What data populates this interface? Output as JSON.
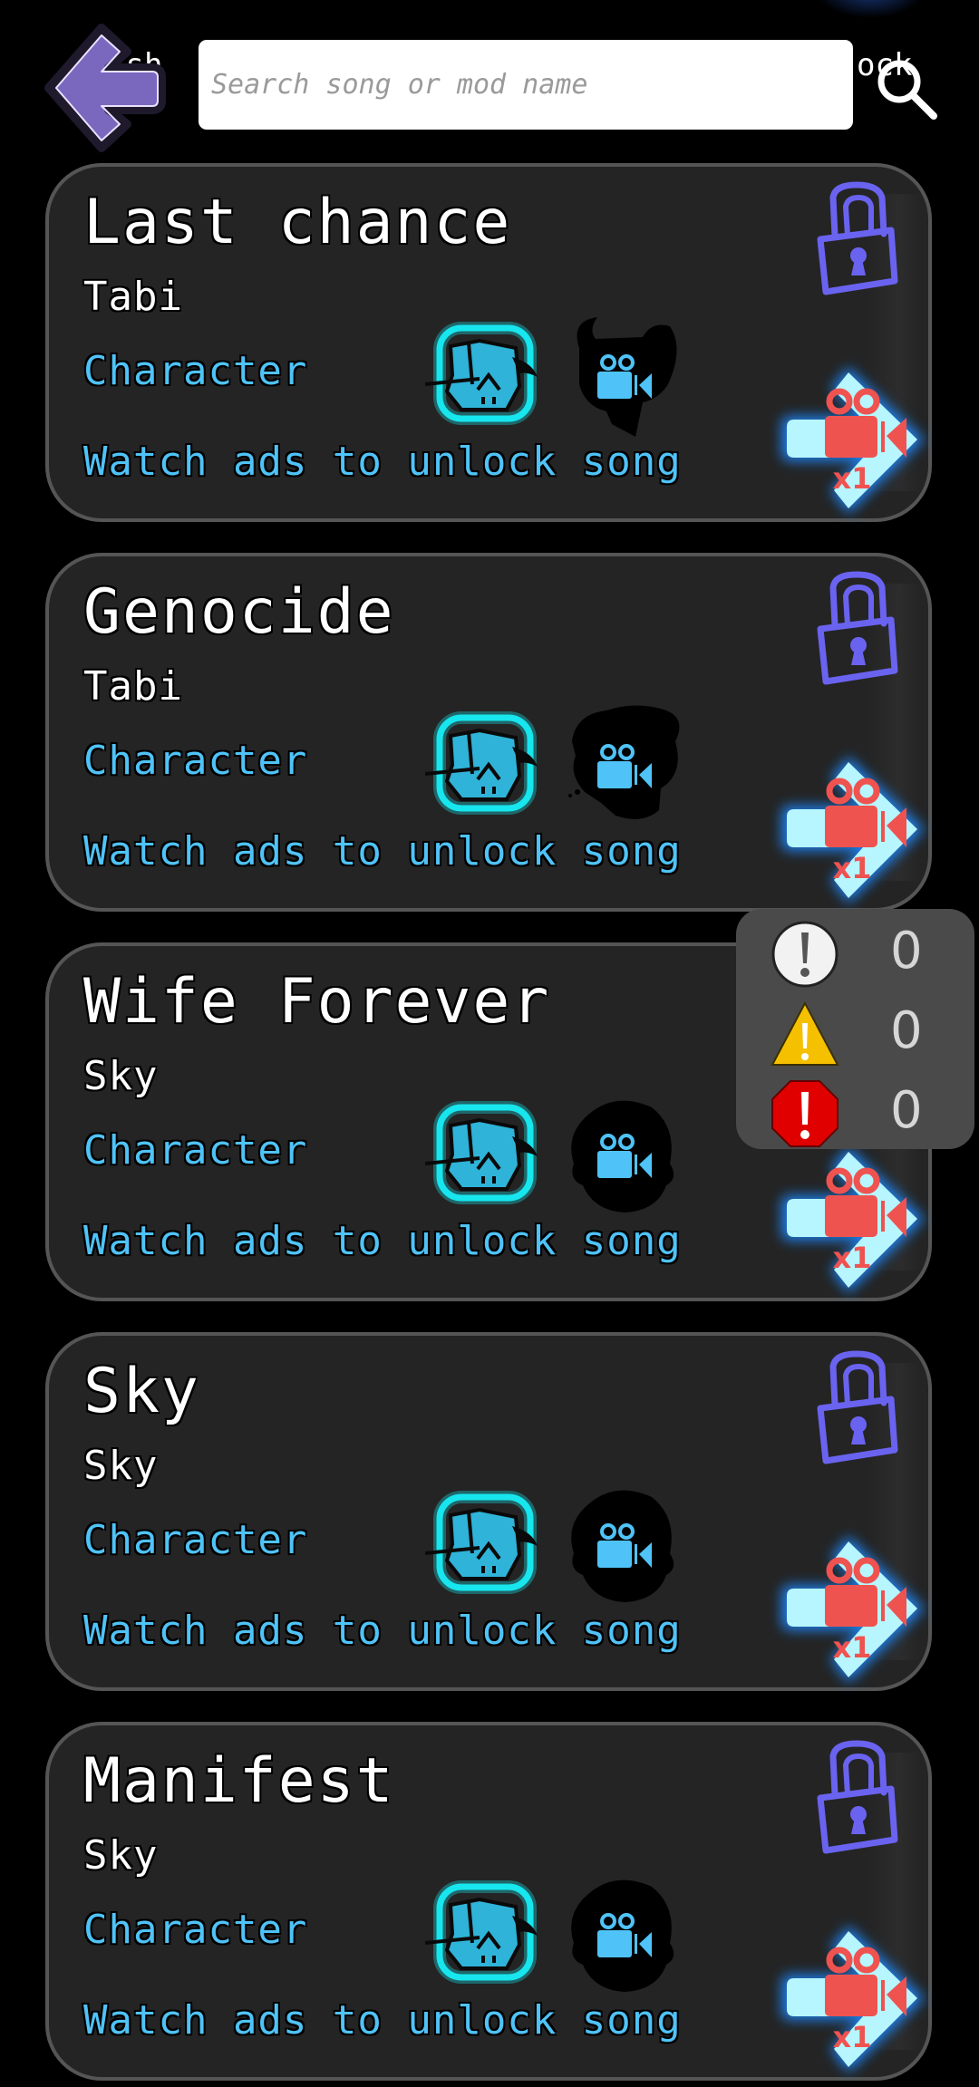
{
  "header": {
    "hidden_left_text": "ish",
    "hidden_right_text": "ock",
    "back_button": "back-arrow",
    "search": {
      "placeholder": "Search song or mod name",
      "value": ""
    },
    "search_icon": "magnifier"
  },
  "songs": [
    {
      "title": "Last chance",
      "mod": "Tabi",
      "character_label": "Character",
      "unlock_text": "Watch ads to unlock song",
      "player_icon": "boyfriend-icon",
      "opponent_icon": "tabi-horned-silhouette",
      "locked": true,
      "ads_required": "x1"
    },
    {
      "title": "Genocide",
      "mod": "Tabi",
      "character_label": "Character",
      "unlock_text": "Watch ads to unlock song",
      "player_icon": "boyfriend-icon",
      "opponent_icon": "tabi-crazed-silhouette",
      "locked": true,
      "ads_required": "x1"
    },
    {
      "title": "Wife Forever",
      "mod": "Sky",
      "character_label": "Character",
      "unlock_text": "Watch ads to unlock song",
      "player_icon": "boyfriend-icon",
      "opponent_icon": "sky-silhouette",
      "locked": true,
      "ads_required": "x1"
    },
    {
      "title": "Sky",
      "mod": "Sky",
      "character_label": "Character",
      "unlock_text": "Watch ads to unlock song",
      "player_icon": "boyfriend-icon",
      "opponent_icon": "sky-silhouette",
      "locked": true,
      "ads_required": "x1"
    },
    {
      "title": "Manifest",
      "mod": "Sky",
      "character_label": "Character",
      "unlock_text": "Watch ads to unlock song",
      "player_icon": "boyfriend-icon",
      "opponent_icon": "sky-silhouette",
      "locked": true,
      "ads_required": "x1"
    }
  ],
  "log_panel": {
    "rows": [
      {
        "icon": "info-icon",
        "count": "0"
      },
      {
        "icon": "warning-icon",
        "count": "0"
      },
      {
        "icon": "error-icon",
        "count": "0"
      }
    ]
  },
  "colors": {
    "background": "#000000",
    "card_bg": "#242424",
    "card_border": "#555555",
    "accent_cyan": "#4fc3f7",
    "lock_purple": "#6a63f0",
    "back_arrow_purple": "#7a68bf",
    "ad_red": "#ef5350",
    "ad_arrow_glow": "#7fe9ff"
  }
}
